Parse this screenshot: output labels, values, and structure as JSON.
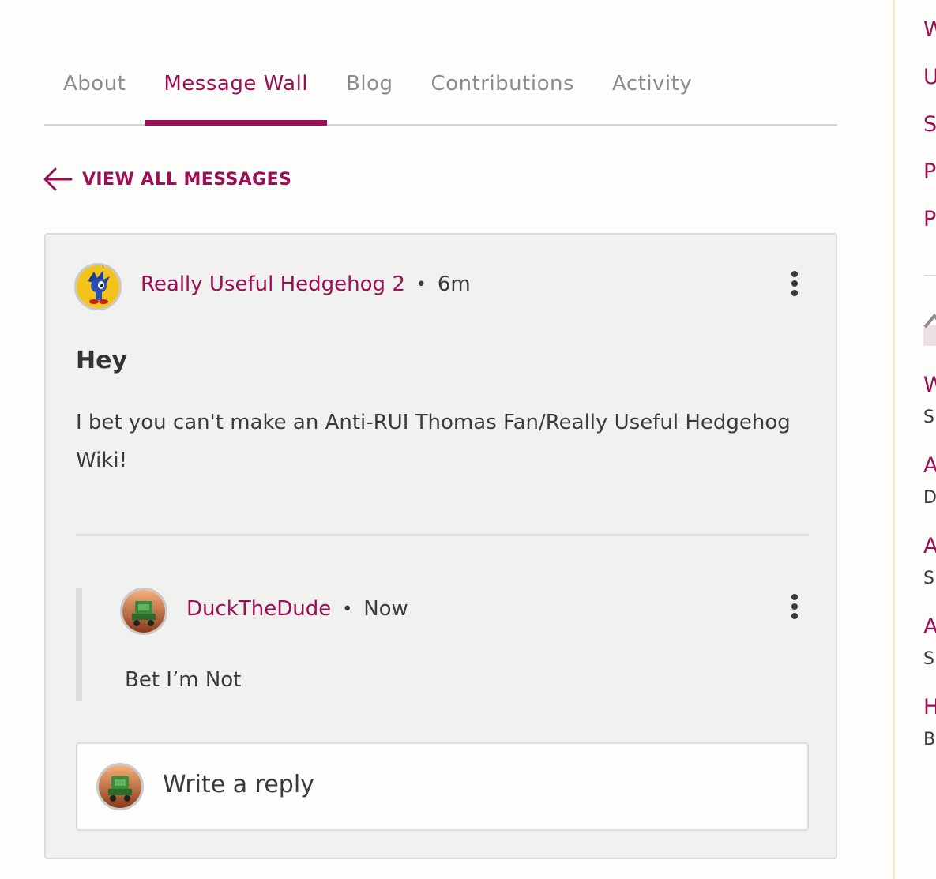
{
  "tabs": [
    {
      "label": "About",
      "active": false
    },
    {
      "label": "Message Wall",
      "active": true
    },
    {
      "label": "Blog",
      "active": false
    },
    {
      "label": "Contributions",
      "active": false
    },
    {
      "label": "Activity",
      "active": false
    }
  ],
  "back_link": {
    "icon": "arrow-left-icon",
    "label": "VIEW ALL MESSAGES"
  },
  "thread": {
    "author": "Really Useful Hedgehog 2",
    "time": "6m",
    "title": "Hey",
    "body": "I bet you can't make an Anti-RUI Thomas Fan/Really Useful Hedgehog Wiki!",
    "reply": {
      "author": "DuckTheDude",
      "time": "Now",
      "body": "Bet I’m Not"
    },
    "reply_box": {
      "placeholder": "Write a reply"
    }
  },
  "rail": {
    "links": [
      "W",
      "U",
      "S",
      "P",
      "P"
    ],
    "items": [
      {
        "title": "W",
        "sub": "S"
      },
      {
        "title": "A",
        "sub": "D"
      },
      {
        "title": "A",
        "sub": "S"
      },
      {
        "title": "A",
        "sub": "S"
      },
      {
        "title": "H",
        "sub": "B"
      }
    ]
  },
  "colors": {
    "accent": "#9c0f55",
    "text": "#3a3a3a",
    "muted": "#8c8c8c",
    "card_bg": "#f1f1f0"
  }
}
